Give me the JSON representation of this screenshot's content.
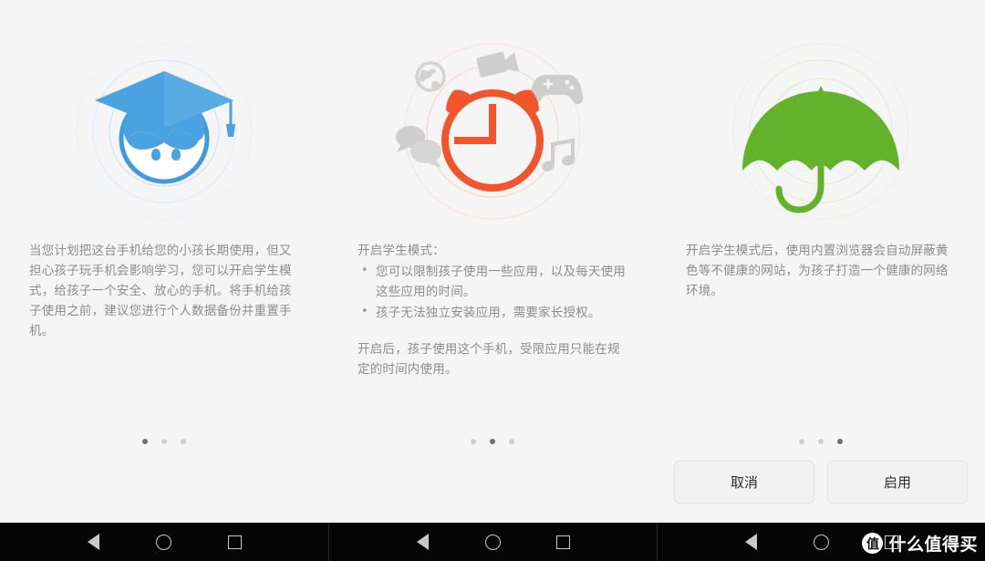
{
  "app": {
    "background_color": "#f5f5f5",
    "feature_name": "学生模式"
  },
  "panels": [
    {
      "id": "panel-intro",
      "illustration": {
        "name": "graduate-child-icon",
        "color": "#4aa3e0",
        "ring_color": "#d6e8f7"
      },
      "body": "当您计划把这台手机给您的小孩长期使用，但又担心孩子玩手机会影响学习，您可以开启学生模式，给孩子一个安全、放心的手机。将手机给孩子使用之前，建议您进行个人数据备份并重置手机。",
      "dots": {
        "count": 3,
        "active": 0
      }
    },
    {
      "id": "panel-limits",
      "illustration": {
        "name": "alarm-clock-icon",
        "color": "#f2552c",
        "ring_color": "#f7d5c9",
        "app_icons": [
          "globe-icon",
          "video-camera-icon",
          "game-controller-icon",
          "music-note-icon",
          "chat-bubbles-icon"
        ],
        "app_icon_color": "#cfcfcf"
      },
      "heading": "开启学生模式：",
      "bullets": [
        "您可以限制孩子使用一些应用，以及每天使用这些应用的时间。",
        "孩子无法独立安装应用，需要家长授权。"
      ],
      "footer": "开启后，孩子使用这个手机，受限应用只能在规定的时间内使用。",
      "dots": {
        "count": 3,
        "active": 1
      }
    },
    {
      "id": "panel-browser",
      "illustration": {
        "name": "umbrella-icon",
        "color": "#63b22c",
        "ring_color": "#dcedcc"
      },
      "body": "开启学生模式后，使用内置浏览器会自动屏蔽黄色等不健康的网站，为孩子打造一个健康的网络环境。",
      "dots": {
        "count": 3,
        "active": 2
      },
      "actions": {
        "cancel_label": "取消",
        "confirm_label": "启用"
      }
    }
  ],
  "navbar": {
    "background_color": "#050505",
    "buttons": [
      {
        "name": "back-button",
        "icon": "triangle-left-icon"
      },
      {
        "name": "home-button",
        "icon": "circle-icon"
      },
      {
        "name": "recents-button",
        "icon": "square-icon"
      }
    ]
  },
  "watermark": {
    "logo_char": "值",
    "text": "什么值得买"
  }
}
